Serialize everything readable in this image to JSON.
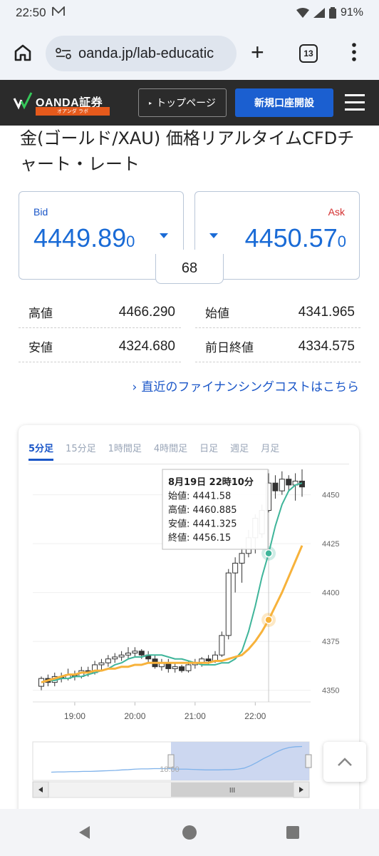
{
  "status": {
    "time": "22:50",
    "battery": "91%"
  },
  "browser": {
    "url": "oanda.jp/lab-educatic",
    "tab_count": "13"
  },
  "header": {
    "logo_text": "OANDA証券",
    "logo_sub": "オアンダ ラボ",
    "top_page": "トップページ",
    "open_account": "新規口座開設"
  },
  "page": {
    "title": "金(ゴールド/XAU) 価格リアルタイムCFDチャート・レート"
  },
  "quote": {
    "bid_label": "Bid",
    "bid_main": "4449.89",
    "bid_small": "0",
    "ask_label": "Ask",
    "ask_main": "4450.57",
    "ask_small": "0",
    "spread": "68"
  },
  "stats": {
    "high_label": "高値",
    "high": "4466.290",
    "open_label": "始値",
    "open": "4341.965",
    "low_label": "安値",
    "low": "4324.680",
    "prev_close_label": "前日終値",
    "prev_close": "4334.575"
  },
  "financing_link": "直近のファイナンシングコストはこちら",
  "chart": {
    "tabs": [
      "5分足",
      "15分足",
      "1時間足",
      "4時間足",
      "日足",
      "週足",
      "月足"
    ],
    "active_tab": 0,
    "tooltip": {
      "date": "8月19日 22時10分",
      "open": "始値: 4441.58",
      "high": "高値: 4460.885",
      "low": "安値: 4441.325",
      "close": "終値: 4456.15"
    },
    "navigator_label": "18:00",
    "scroll_thumb": "III",
    "colors": {
      "fast_ma": "#3fb59a",
      "slow_ma": "#f7b23b",
      "navigator_line": "#7fb2ea",
      "navigator_window": "#c6d3ee"
    }
  },
  "chart_data": {
    "type": "candlestick",
    "x_ticks": [
      "19:00",
      "20:00",
      "21:00",
      "22:00"
    ],
    "y_ticks": [
      4350,
      4375,
      4400,
      4425,
      4450
    ],
    "ylim": [
      4344,
      4463
    ],
    "series": [
      {
        "values": [
          4354,
          4355,
          4355,
          4356,
          4356,
          4357,
          4357,
          4358,
          4359,
          4360,
          4361,
          4363,
          4364,
          4366,
          4367,
          4367,
          4368,
          4368,
          4368,
          4367,
          4366,
          4366,
          4365,
          4364,
          4363,
          4363,
          4363,
          4364,
          4364,
          4366,
          4370,
          4380,
          4393,
          4408,
          4420,
          4434,
          4445,
          4452,
          4455,
          4456
        ]
      },
      {
        "values": [
          4354,
          4355,
          4356,
          4357,
          4358,
          4358,
          4359,
          4359,
          4360,
          4360,
          4361,
          4361,
          4362,
          4362,
          4363,
          4363,
          4364,
          4364,
          4364,
          4364,
          4364,
          4364,
          4364,
          4364,
          4364,
          4364,
          4365,
          4365,
          4366,
          4367,
          4368,
          4371,
          4375,
          4380,
          4386,
          4393,
          4400,
          4408,
          4416,
          4424
        ]
      }
    ],
    "candles": [
      [
        4352,
        4356,
        4350,
        4357
      ],
      [
        4356,
        4354,
        4352,
        4358
      ],
      [
        4354,
        4357,
        4352,
        4359
      ],
      [
        4357,
        4356,
        4354,
        4359
      ],
      [
        4356,
        4358,
        4355,
        4361
      ],
      [
        4358,
        4357,
        4355,
        4360
      ],
      [
        4357,
        4360,
        4356,
        4362
      ],
      [
        4360,
        4359,
        4357,
        4362
      ],
      [
        4359,
        4363,
        4358,
        4365
      ],
      [
        4363,
        4364,
        4360,
        4366
      ],
      [
        4364,
        4366,
        4362,
        4368
      ],
      [
        4366,
        4367,
        4364,
        4369
      ],
      [
        4367,
        4368,
        4365,
        4370
      ],
      [
        4368,
        4369,
        4366,
        4372
      ],
      [
        4369,
        4370,
        4367,
        4372
      ],
      [
        4370,
        4368,
        4366,
        4371
      ],
      [
        4368,
        4366,
        4364,
        4370
      ],
      [
        4366,
        4362,
        4361,
        4368
      ],
      [
        4362,
        4364,
        4360,
        4366
      ],
      [
        4364,
        4361,
        4359,
        4366
      ],
      [
        4361,
        4362,
        4359,
        4364
      ],
      [
        4362,
        4360,
        4359,
        4363
      ],
      [
        4360,
        4363,
        4359,
        4365
      ],
      [
        4363,
        4364,
        4361,
        4366
      ],
      [
        4364,
        4366,
        4362,
        4367
      ],
      [
        4366,
        4365,
        4363,
        4368
      ],
      [
        4365,
        4368,
        4364,
        4370
      ],
      [
        4368,
        4378,
        4367,
        4380
      ],
      [
        4378,
        4410,
        4376,
        4412
      ],
      [
        4410,
        4415,
        4400,
        4418
      ],
      [
        4415,
        4420,
        4405,
        4423
      ],
      [
        4420,
        4428,
        4418,
        4432
      ],
      [
        4428,
        4438,
        4420,
        4440
      ],
      [
        4430,
        4442,
        4428,
        4445
      ],
      [
        4442,
        4456,
        4441,
        4461
      ],
      [
        4456,
        4452,
        4448,
        4460
      ],
      [
        4452,
        4458,
        4450,
        4462
      ],
      [
        4458,
        4455,
        4452,
        4460
      ],
      [
        4455,
        4457,
        4447,
        4461
      ],
      [
        4457,
        4454,
        4449,
        4463
      ]
    ]
  }
}
